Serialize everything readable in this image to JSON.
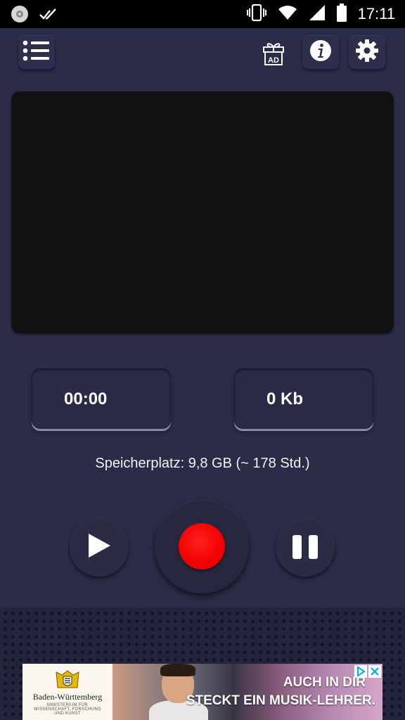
{
  "status_bar": {
    "time": "17:11",
    "icons": [
      "app-notification-icon",
      "double-check-icon",
      "vibrate-icon",
      "wifi-icon",
      "cell-signal-icon",
      "battery-icon"
    ]
  },
  "toolbar": {
    "menu_icon": "list-menu-icon",
    "gift_icon": "gift-ad-icon",
    "gift_label": "AD",
    "info_icon": "info-icon",
    "settings_icon": "gear-icon"
  },
  "recorder": {
    "duration": "00:00",
    "file_size": "0 Kb",
    "storage": "Speicherplatz: 9,8 GB (~ 178 Std.)"
  },
  "controls": {
    "play_icon": "play-icon",
    "record_icon": "record-icon",
    "pause_icon": "pause-icon",
    "record_color": "#f20000"
  },
  "ad": {
    "brand": "Baden-Württemberg",
    "tagline": "MINISTERIUM FÜR WISSENSCHAFT, FORSCHUNG UND KUNST",
    "headline_1": "AUCH IN DIR",
    "headline_2": "STECKT EIN MUSIK-LEHRER."
  },
  "colors": {
    "background": "#2b2c48",
    "display": "#111111",
    "accent_record": "#f20000"
  }
}
